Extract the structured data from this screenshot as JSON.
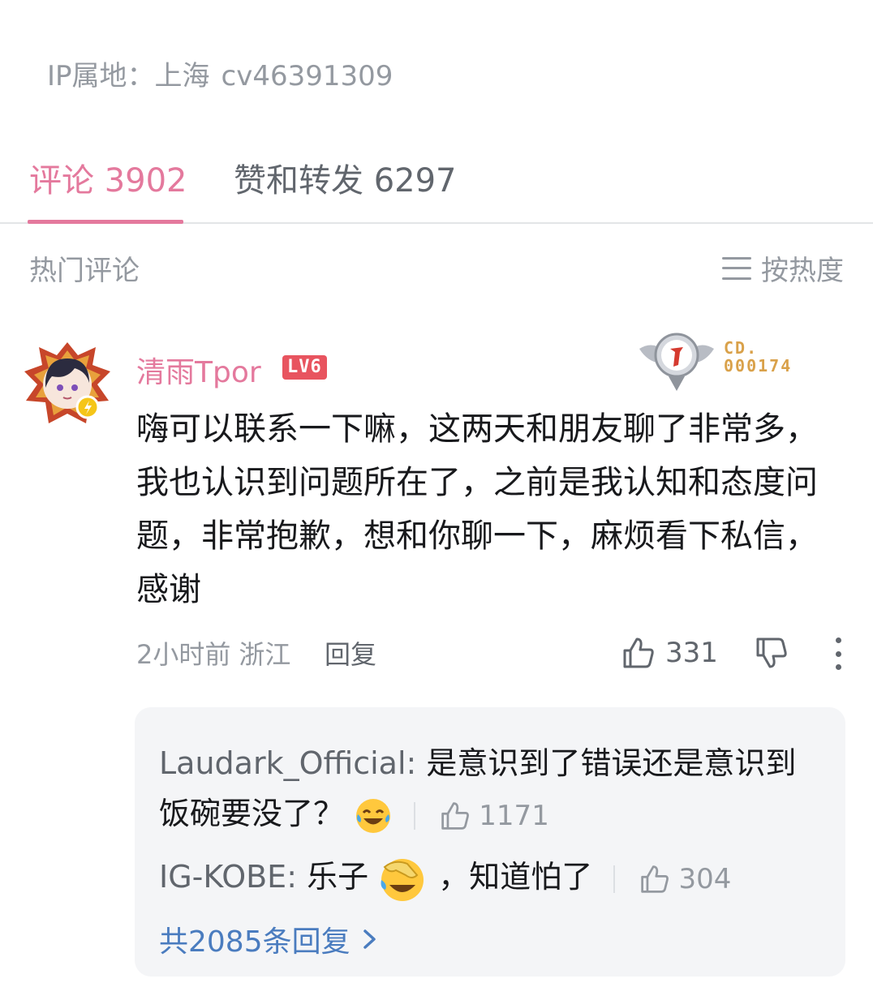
{
  "header": {
    "ip_label": "IP属地：上海",
    "cv_id": "cv46391309"
  },
  "tabs": [
    {
      "label": "评论 3902",
      "active": true
    },
    {
      "label": "赞和转发 6297",
      "active": false
    }
  ],
  "comments_section": {
    "title": "热门评论",
    "sort_label": "按热度",
    "sort_icon": "list-icon"
  },
  "comment": {
    "username": "清雨Tpor",
    "level": "LV6",
    "medal_code_line1": "CD.",
    "medal_code_line2": "000174",
    "text": "嗨可以联系一下嘛，这两天和朋友聊了非常多，我也认识到问题所在了，之前是我认知和态度问题，非常抱歉，想和你聊一下，麻烦看下私信，感谢",
    "time": "2小时前",
    "location": "浙江",
    "reply_label": "回复",
    "like_count": "331"
  },
  "replies": [
    {
      "name": "Laudark_Official:",
      "text": " 是意识到了错误还是意识到饭碗要没了？",
      "emoji": "laughing-tears-emoji",
      "like_count": "1171"
    },
    {
      "name": "IG-KOBE:",
      "text_before": " 乐子",
      "emoji": "facepalm-laugh-emoji",
      "text_after": "，知道怕了",
      "like_count": "304"
    }
  ],
  "all_replies_label": "共2085条回复",
  "colors": {
    "accent_pink": "#e4799d",
    "link_blue": "#4a7cbf",
    "muted_gray": "#9499a0",
    "level_red": "#e8545f"
  }
}
